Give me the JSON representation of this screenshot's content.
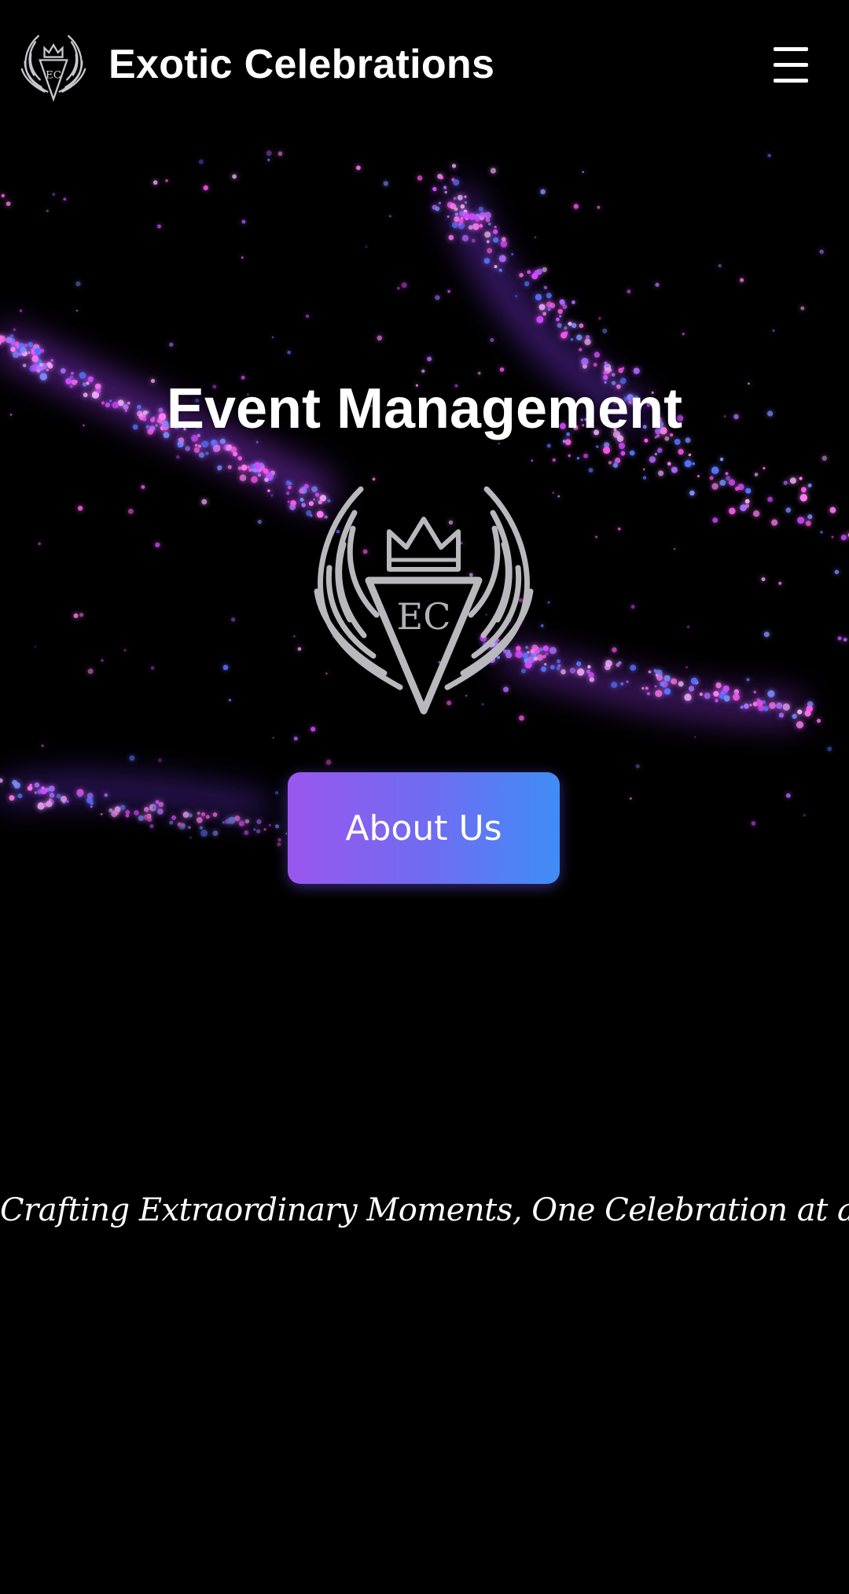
{
  "header": {
    "brand_name": "Exotic Celebrations",
    "logo_icon": "winged-crown-emblem-icon",
    "menu_icon": "hamburger-menu-icon"
  },
  "hero": {
    "title": "Event Management",
    "emblem_icon": "winged-crown-emblem-icon",
    "background": "purple-blue-sparkle-particles",
    "about_button_label": "About Us"
  },
  "tagline": "Crafting Extraordinary Moments, One Celebration at a Time",
  "colors": {
    "background": "#000000",
    "text": "#ffffff",
    "button_gradient_start": "#9a56ee",
    "button_gradient_end": "#3f8df7",
    "sparkle_magenta": "#e040fb",
    "sparkle_blue": "#4a6cff",
    "emblem_silver": "#b9b9bd"
  }
}
